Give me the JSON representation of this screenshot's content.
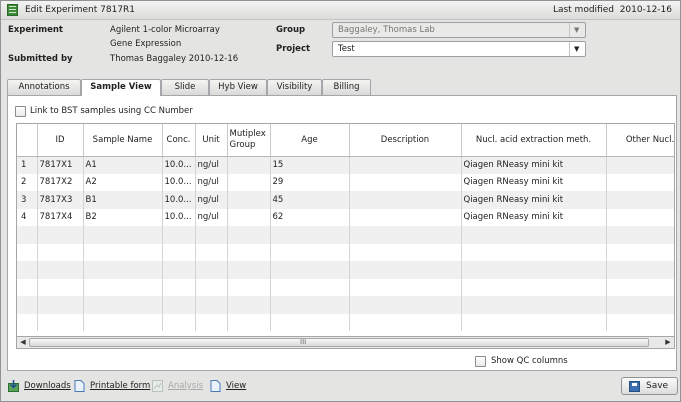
{
  "window": {
    "title": "Edit Experiment 7817R1",
    "last_modified_label": "Last modified",
    "last_modified_date": "2010-12-16"
  },
  "header": {
    "experiment_label": "Experiment",
    "experiment_line1": "Agilent 1-color Microarray",
    "experiment_line2": "Gene Expression",
    "submitted_label": "Submitted by",
    "submitted_value": "Thomas Baggaley  2010-12-16",
    "group_label": "Group",
    "group_value": "Baggaley, Thomas Lab",
    "project_label": "Project",
    "project_value": "Test"
  },
  "tabs": [
    {
      "label": "Annotations"
    },
    {
      "label": "Sample View"
    },
    {
      "label": "Slide"
    },
    {
      "label": "Hyb View"
    },
    {
      "label": "Visibility"
    },
    {
      "label": "Billing"
    }
  ],
  "active_tab": "Sample View",
  "link_bst_label": "Link to BST samples using CC Number",
  "grid": {
    "columns": [
      "",
      "ID",
      "Sample Name",
      "Conc.",
      "Unit",
      "Mutiplex Group",
      "Age",
      "Description",
      "Nucl. acid extraction meth.",
      "Other Nucl. aci"
    ],
    "rows": [
      [
        "1",
        "7817X1",
        "A1",
        "10.0...",
        "ng/ul",
        "",
        "15",
        "",
        "Qiagen RNeasy mini kit",
        ""
      ],
      [
        "2",
        "7817X2",
        "A2",
        "10.0...",
        "ng/ul",
        "",
        "29",
        "",
        "Qiagen RNeasy mini kit",
        ""
      ],
      [
        "3",
        "7817X3",
        "B1",
        "10.0...",
        "ng/ul",
        "",
        "45",
        "",
        "Qiagen RNeasy mini kit",
        ""
      ],
      [
        "4",
        "7817X4",
        "B2",
        "10.0...",
        "ng/ul",
        "",
        "62",
        "",
        "Qiagen RNeasy mini kit",
        ""
      ]
    ],
    "scroll_grip": "III"
  },
  "show_qc_label": "Show QC columns",
  "footer": {
    "downloads": "Downloads",
    "printable_form": "Printable form",
    "analysis": "Analysis",
    "view": "View",
    "save": "Save"
  },
  "colors": {
    "window_bg": "#e4e4e2",
    "row_alt": "#f0f0f0",
    "accent_green": "#3d8a3a"
  }
}
